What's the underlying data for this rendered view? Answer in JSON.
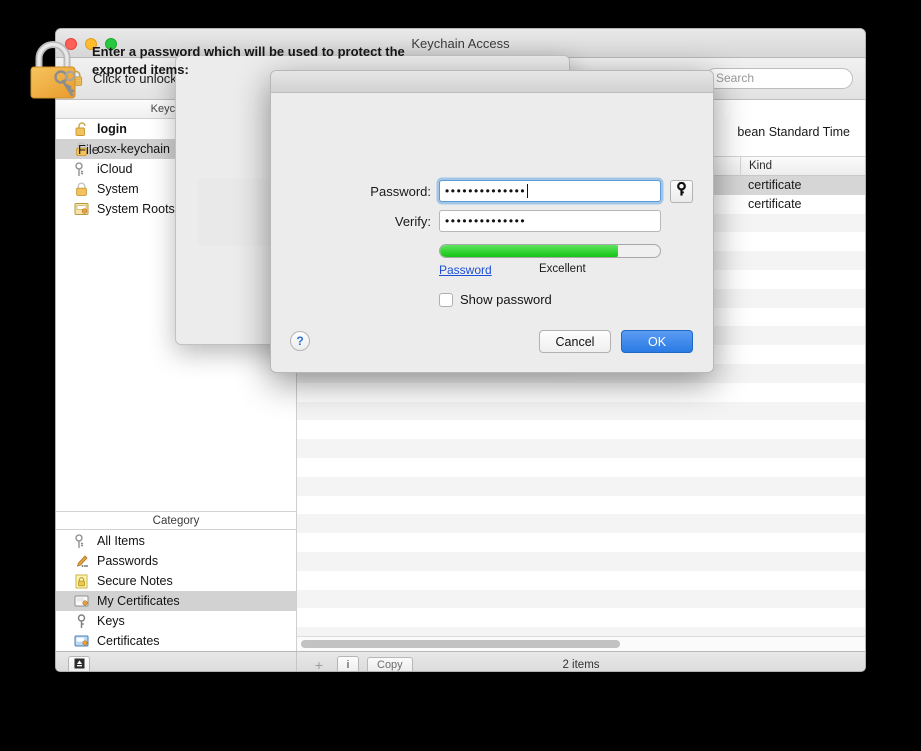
{
  "window": {
    "title": "Keychain Access",
    "toolbar": {
      "unlock_label": "Click to unlock",
      "lock_icon": "padlock-closed-icon",
      "search_placeholder": "Search"
    }
  },
  "sidebar": {
    "keychains_header": "Keychains",
    "keychains": [
      {
        "label": "login",
        "icon": "padlock-open-icon",
        "selected": false,
        "bold": true
      },
      {
        "label": "osx-keychain",
        "icon": "padlock-closed-icon",
        "selected": true,
        "bold": false
      },
      {
        "label": "iCloud",
        "icon": "keyring-icon",
        "selected": false,
        "bold": false
      },
      {
        "label": "System",
        "icon": "padlock-closed-icon",
        "selected": false,
        "bold": false
      },
      {
        "label": "System Roots",
        "icon": "certificate-icon",
        "selected": false,
        "bold": false
      }
    ],
    "category_header": "Category",
    "categories": [
      {
        "label": "All Items",
        "icon": "keyring-icon",
        "selected": false
      },
      {
        "label": "Passwords",
        "icon": "pencil-icon",
        "selected": false
      },
      {
        "label": "Secure Notes",
        "icon": "yellow-lock-icon",
        "selected": false
      },
      {
        "label": "My Certificates",
        "icon": "certificate-icon",
        "selected": true
      },
      {
        "label": "Keys",
        "icon": "key-icon",
        "selected": false
      },
      {
        "label": "Certificates",
        "icon": "certificate-blue-icon",
        "selected": false
      }
    ]
  },
  "content": {
    "detail_text": "bean Standard Time",
    "column_kind": "Kind",
    "rows": [
      {
        "kind": "certificate",
        "selected": true
      },
      {
        "kind": "certificate",
        "selected": false
      }
    ]
  },
  "bottom_bar": {
    "show_hide_icon": "eject-icon",
    "add_label": "+",
    "info_label": "i",
    "copy_label": "Copy",
    "item_count": "2 items"
  },
  "save_panel": {
    "file_label": "File"
  },
  "password_dialog": {
    "icon": "padlock-with-keys-icon",
    "heading": "Enter a password which will be used to protect the exported items:",
    "password_label": "Password:",
    "password_value": "••••••••••••••",
    "verify_label": "Verify:",
    "verify_value": "••••••••••••••",
    "key_button_icon": "key-icon",
    "strength_percent": 81,
    "strength_link": "Password",
    "strength_text": "Excellent",
    "show_password_label": "Show password",
    "show_password_checked": false,
    "help_label": "?",
    "cancel_label": "Cancel",
    "ok_label": "OK"
  },
  "colors": {
    "accent_blue": "#2a7ae4",
    "strength_green": "#15c415",
    "link_blue": "#1b4fd8",
    "selection_gray": "#d2d2d2"
  }
}
